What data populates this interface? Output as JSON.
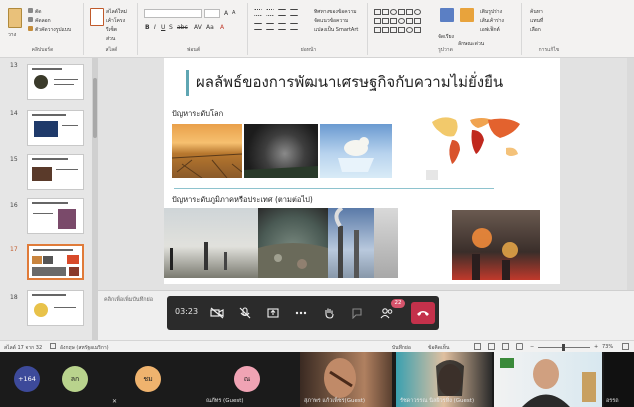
{
  "ribbon": {
    "groups": [
      {
        "label": "คลิปบอร์ด"
      },
      {
        "label": "สไลด์"
      },
      {
        "label": "ฟอนต์"
      },
      {
        "label": "ย่อหน้า"
      },
      {
        "label": "รูปวาด"
      },
      {
        "label": "การแก้ไข"
      }
    ],
    "clipboard_items": [
      "วาง",
      "ตัด",
      "คัดลอก",
      "ตัวคัดวางรูปแบบ"
    ],
    "slide_items": [
      "สไลด์ใหม่",
      "เค้าโครง",
      "รีเซ็ต",
      "ส่วน"
    ],
    "paragraph_items": [
      "ทิศทางของข้อความ",
      "จัดแนวข้อความ",
      "แปลงเป็น SmartArt"
    ],
    "drawing_items": [
      "จัดเรียง",
      "ลักษณะด่วน",
      "เติมรูปร่าง",
      "เส้นเค้าร่าง",
      "เอฟเฟ็กต์"
    ],
    "editing_items": [
      "ค้นหา",
      "แทนที่",
      "เลือก"
    ]
  },
  "thumbnails": [
    {
      "number": "13",
      "selected": false
    },
    {
      "number": "14",
      "selected": false
    },
    {
      "number": "15",
      "selected": false
    },
    {
      "number": "16",
      "selected": false
    },
    {
      "number": "17",
      "selected": true
    },
    {
      "number": "18",
      "selected": false
    }
  ],
  "slide": {
    "title": "ผลลัพธ์ของการพัฒนาเศรษฐกิจกับความไม่ยั่งยืน",
    "heading1": "ปัญหาระดับโลก",
    "heading2": "ปัญหาระดับภูมิภาคหรือประเทศ (ตามต่อไป)"
  },
  "notes": {
    "placeholder": "คลิกเพื่อเพิ่มบันทึกย่อ"
  },
  "callbar": {
    "timer": "03:23",
    "participant_badge": "22",
    "icons": [
      "camera-off-icon",
      "mic-off-icon",
      "share-icon",
      "more-icon",
      "raise-hand-icon",
      "chat-icon",
      "participants-icon",
      "hang-up-icon"
    ],
    "colors": {
      "hangup": "#c4314b",
      "badge": "#d6546c"
    }
  },
  "statusbar": {
    "slide_info": "สไลด์ 17 จาก 32",
    "language": "อังกฤษ (สหรัฐอเมริกา)",
    "notes": "บันทึกย่อ",
    "comments": "ข้อคิดเห็น",
    "zoom": "73%"
  },
  "participants": {
    "more_count": "+164",
    "avatars": [
      {
        "initials": "ลก",
        "color": "#b9d38d"
      },
      {
        "initials": "ชม",
        "color": "#efb36e"
      },
      {
        "initials": "ณ",
        "color": "#f0a3b4"
      }
    ],
    "names": [
      "ณภัทร (Guest)",
      "สุภาพร แก้วเพ็ชร(Guest)",
      "รัชดาวรรณ นิลผิวรหิ่ง (Guest)",
      "อรรถ"
    ]
  }
}
